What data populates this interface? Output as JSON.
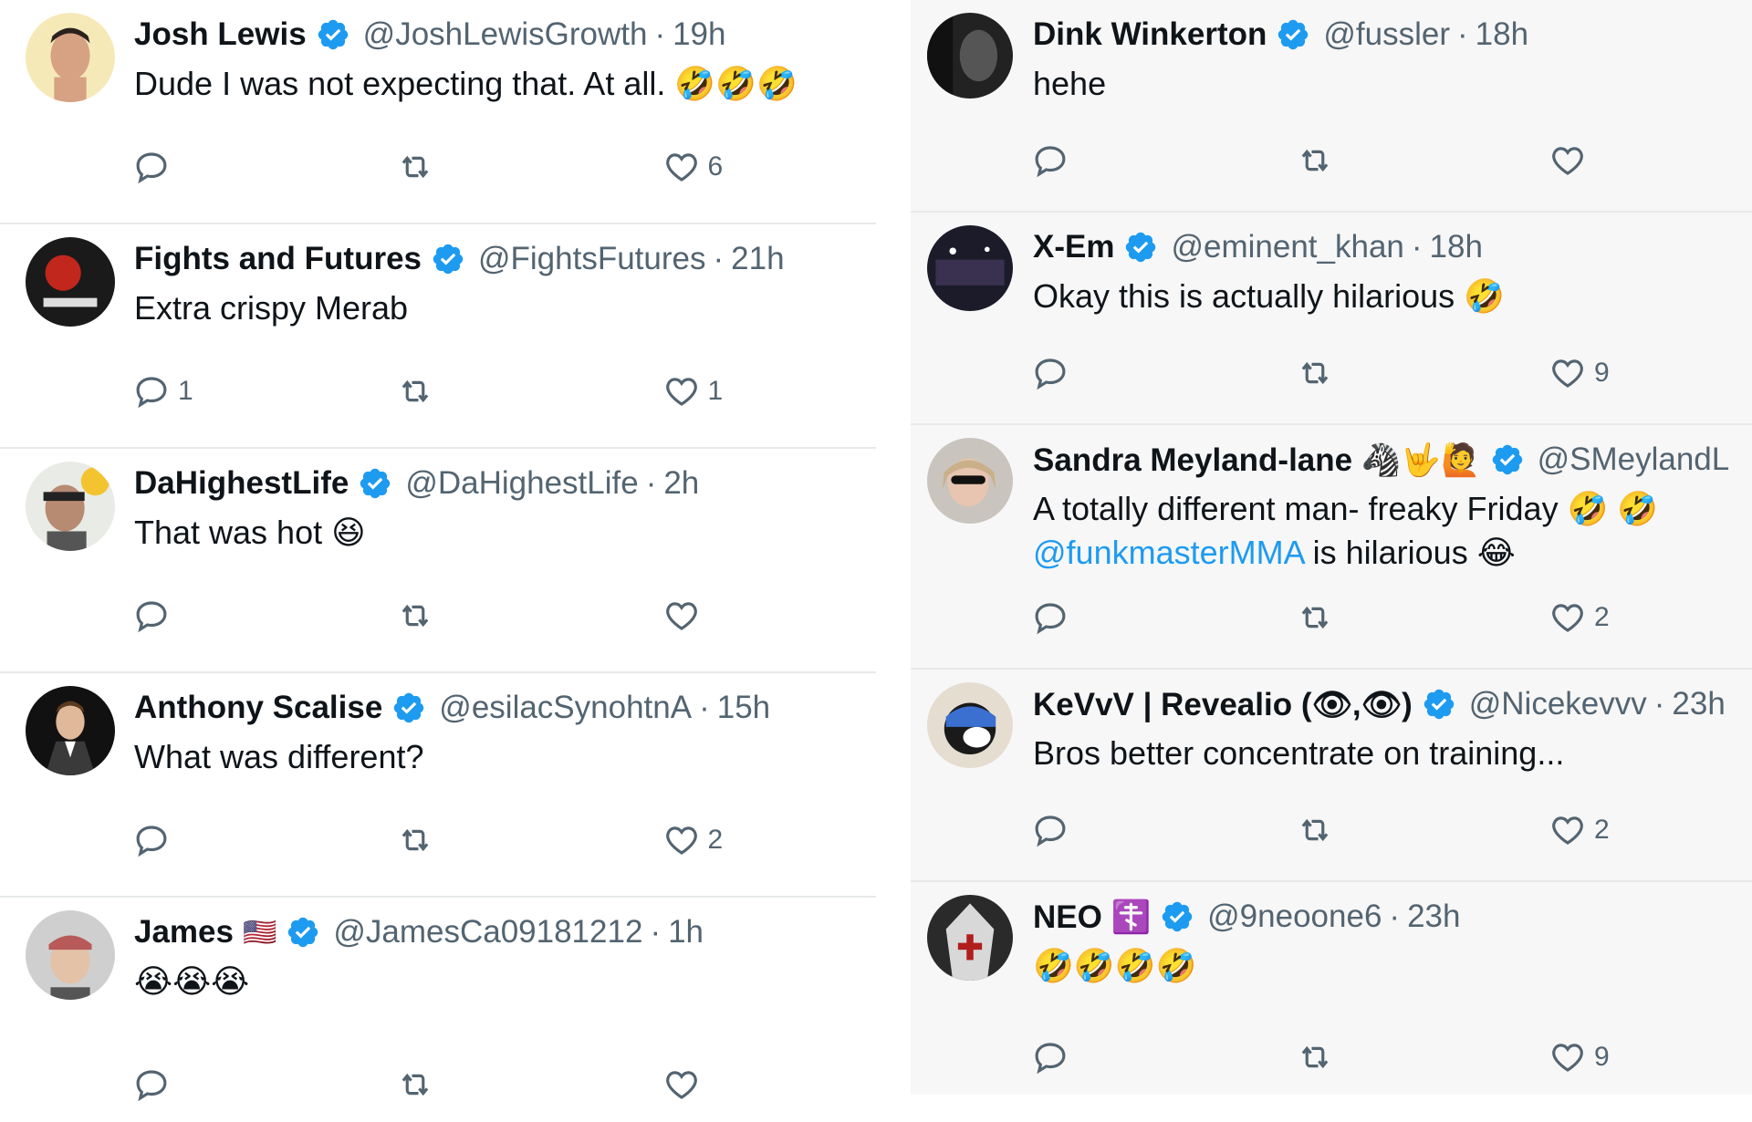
{
  "left": [
    {
      "name": "Josh Lewis",
      "flag": "",
      "handle": "@JoshLewisGrowth",
      "time": "19h",
      "text": "Dude I was not expecting that. At all. 🤣🤣🤣",
      "replies": "",
      "likes": "6"
    },
    {
      "name": "Fights and Futures",
      "flag": "",
      "handle": "@FightsFutures",
      "time": "21h",
      "text": "Extra crispy Merab",
      "replies": "1",
      "likes": "1"
    },
    {
      "name": "DaHighestLife",
      "flag": "",
      "handle": "@DaHighestLife",
      "time": "2h",
      "text": "That was hot 😆",
      "replies": "",
      "likes": ""
    },
    {
      "name": "Anthony Scalise",
      "flag": "",
      "handle": "@esilacSynohtnA",
      "time": "15h",
      "text": "What was different?",
      "replies": "",
      "likes": "2"
    },
    {
      "name": "James",
      "flag": "🇺🇸",
      "handle": "@JamesCa09181212",
      "time": "1h",
      "text": "😭😭😭",
      "replies": "",
      "likes": ""
    }
  ],
  "right": [
    {
      "name": "Dink Winkerton",
      "flag": "",
      "handle": "@fussler",
      "time": "18h",
      "text": "hehe",
      "replies": "",
      "likes": ""
    },
    {
      "name": "X-Em",
      "flag": "",
      "handle": "@eminent_khan",
      "time": "18h",
      "text": "Okay this is actually hilarious 🤣",
      "replies": "",
      "likes": "9"
    },
    {
      "name": "Sandra Meyland-lane 🦓🤟🙋",
      "flag": "",
      "handle": "@SMeylandL",
      "time": "",
      "text": "A totally different man- freaky Friday 🤣 🤣",
      "mention": "@funkmasterMMA",
      "text2": " is hilarious 😂",
      "replies": "",
      "likes": "2"
    },
    {
      "name": "KeVvV | Revealio (👁,👁)",
      "flag": "",
      "handle": "@Nicekevvv",
      "time": "23h",
      "text": "Bros better concentrate on training...",
      "replies": "",
      "likes": "2"
    },
    {
      "name": "NEO ☦️",
      "flag": "",
      "handle": "@9neoone6",
      "time": "23h",
      "text": "🤣🤣🤣🤣",
      "replies": "",
      "likes": "9"
    }
  ],
  "icons": {
    "reply": "reply-icon",
    "retweet": "retweet-icon",
    "like": "heart-icon",
    "verified": "verified-badge-icon"
  },
  "colors": {
    "verified": "#1d9bf0",
    "muted": "#536471",
    "mention": "#1d9bf0"
  }
}
